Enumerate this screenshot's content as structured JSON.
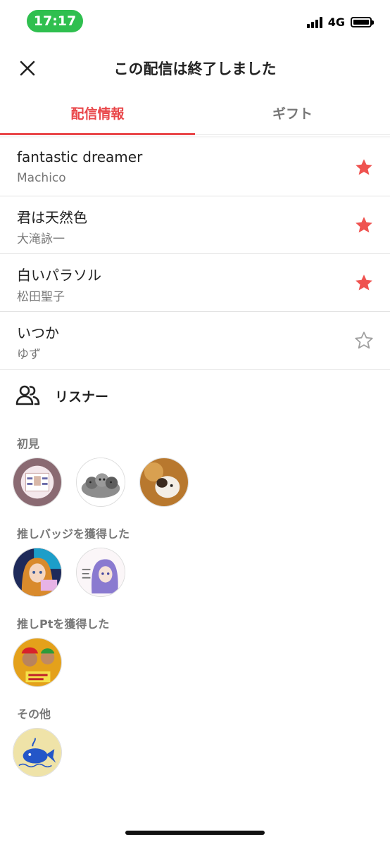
{
  "status_bar": {
    "time": "17:17",
    "network": "4G"
  },
  "header": {
    "title": "この配信は終了しました"
  },
  "tabs": [
    {
      "label": "配信情報",
      "active": true
    },
    {
      "label": "ギフト",
      "active": false
    }
  ],
  "songs": [
    {
      "title": "fantastic dreamer",
      "artist": "Machico",
      "starred": true
    },
    {
      "title": "君は天然色",
      "artist": "大滝詠一",
      "starred": true
    },
    {
      "title": "白いパラソル",
      "artist": "松田聖子",
      "starred": true
    },
    {
      "title": "いつか",
      "artist": "ゆず",
      "starred": false
    }
  ],
  "listeners": {
    "title": "リスナー",
    "groups": [
      {
        "label": "初見",
        "avatar_count": 3
      },
      {
        "label": "推しバッジを獲得した",
        "avatar_count": 2
      },
      {
        "label": "推しPtを獲得した",
        "avatar_count": 1
      },
      {
        "label": "その他",
        "avatar_count": 1
      }
    ]
  },
  "colors": {
    "accent": "#e9474a",
    "star_filled": "#ef5350",
    "star_empty": "#9e9e9e"
  }
}
